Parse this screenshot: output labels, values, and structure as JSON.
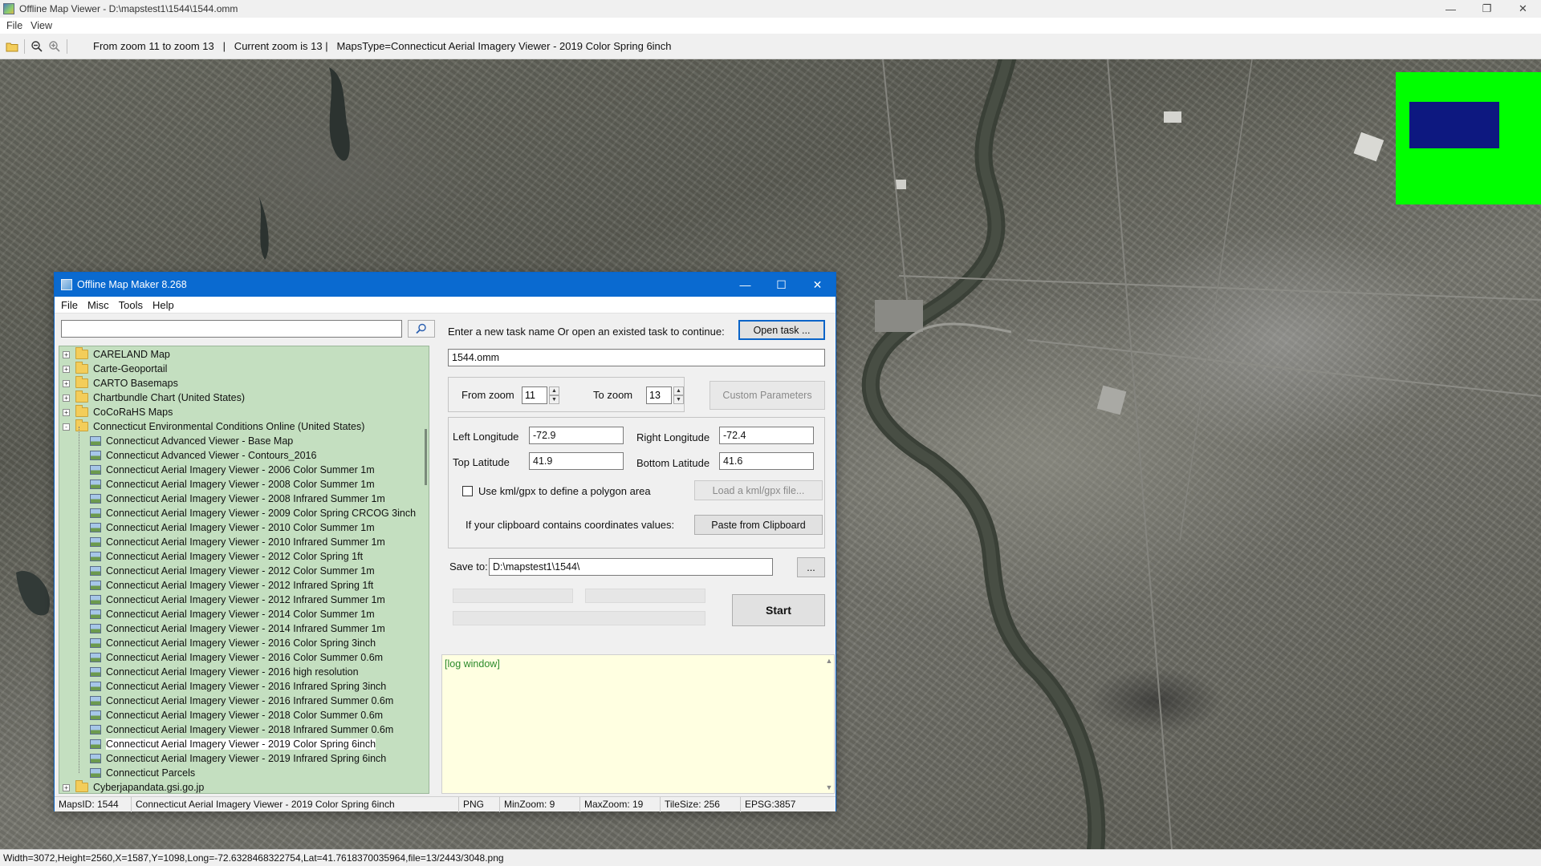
{
  "viewer": {
    "title": "Offline Map Viewer - D:\\mapstest1\\1544\\1544.omm",
    "menu": [
      "File",
      "View"
    ],
    "toolbar_status": "From zoom 11 to zoom 13   |   Current zoom is 13 |   MapsType=Connecticut Aerial Imagery Viewer - 2019 Color Spring 6inch",
    "statusbar": "Width=3072,Height=2560,X=1587,Y=1098,Long=-72.6328468322754,Lat=41.7618370035964,file=13/2443/3048.png",
    "overview_colors": {
      "background": "#00ff00",
      "viewport": "#0d1880"
    }
  },
  "dialog": {
    "title": "Offline Map Maker 8.268",
    "menu": [
      "File",
      "Misc",
      "Tools",
      "Help"
    ],
    "search_placeholder": "",
    "tree": [
      {
        "label": "CARELAND Map",
        "type": "folder",
        "level": 0,
        "expander": "+"
      },
      {
        "label": "Carte-Geoportail",
        "type": "folder",
        "level": 0,
        "expander": "+"
      },
      {
        "label": "CARTO Basemaps",
        "type": "folder",
        "level": 0,
        "expander": "+"
      },
      {
        "label": "Chartbundle Chart (United States)",
        "type": "folder",
        "level": 0,
        "expander": "+"
      },
      {
        "label": "CoCoRaHS Maps",
        "type": "folder",
        "level": 0,
        "expander": "+"
      },
      {
        "label": "Connecticut Environmental Conditions Online (United States)",
        "type": "folder-open",
        "level": 0,
        "expander": "−"
      },
      {
        "label": "Connecticut Advanced Viewer - Base Map",
        "type": "map",
        "level": 1
      },
      {
        "label": "Connecticut Advanced Viewer - Contours_2016",
        "type": "map",
        "level": 1
      },
      {
        "label": "Connecticut Aerial Imagery Viewer - 2006 Color Summer 1m",
        "type": "map",
        "level": 1
      },
      {
        "label": "Connecticut Aerial Imagery Viewer - 2008 Color Summer 1m",
        "type": "map",
        "level": 1
      },
      {
        "label": "Connecticut Aerial Imagery Viewer - 2008 Infrared Summer 1m",
        "type": "map",
        "level": 1
      },
      {
        "label": "Connecticut Aerial Imagery Viewer - 2009 Color Spring CRCOG 3inch",
        "type": "map",
        "level": 1
      },
      {
        "label": "Connecticut Aerial Imagery Viewer - 2010 Color Summer 1m",
        "type": "map",
        "level": 1
      },
      {
        "label": "Connecticut Aerial Imagery Viewer - 2010 Infrared Summer 1m",
        "type": "map",
        "level": 1
      },
      {
        "label": "Connecticut Aerial Imagery Viewer - 2012 Color Spring 1ft",
        "type": "map",
        "level": 1
      },
      {
        "label": "Connecticut Aerial Imagery Viewer - 2012 Color Summer 1m",
        "type": "map",
        "level": 1
      },
      {
        "label": "Connecticut Aerial Imagery Viewer - 2012 Infrared Spring 1ft",
        "type": "map",
        "level": 1
      },
      {
        "label": "Connecticut Aerial Imagery Viewer - 2012 Infrared Summer 1m",
        "type": "map",
        "level": 1
      },
      {
        "label": "Connecticut Aerial Imagery Viewer - 2014 Color Summer 1m",
        "type": "map",
        "level": 1
      },
      {
        "label": "Connecticut Aerial Imagery Viewer - 2014 Infrared Summer 1m",
        "type": "map",
        "level": 1
      },
      {
        "label": "Connecticut Aerial Imagery Viewer - 2016 Color Spring 3inch",
        "type": "map",
        "level": 1
      },
      {
        "label": "Connecticut Aerial Imagery Viewer - 2016 Color Summer 0.6m",
        "type": "map",
        "level": 1
      },
      {
        "label": "Connecticut Aerial Imagery Viewer - 2016 high resolution",
        "type": "map",
        "level": 1
      },
      {
        "label": "Connecticut Aerial Imagery Viewer - 2016 Infrared Spring 3inch",
        "type": "map",
        "level": 1
      },
      {
        "label": "Connecticut Aerial Imagery Viewer - 2016 Infrared Summer 0.6m",
        "type": "map",
        "level": 1
      },
      {
        "label": "Connecticut Aerial Imagery Viewer - 2018 Color Summer 0.6m",
        "type": "map",
        "level": 1
      },
      {
        "label": "Connecticut Aerial Imagery Viewer - 2018 Infrared Summer 0.6m",
        "type": "map",
        "level": 1
      },
      {
        "label": "Connecticut Aerial Imagery Viewer - 2019 Color Spring 6inch",
        "type": "map",
        "level": 1,
        "selected": true
      },
      {
        "label": "Connecticut Aerial Imagery Viewer - 2019 Infrared Spring 6inch",
        "type": "map",
        "level": 1
      },
      {
        "label": "Connecticut Parcels",
        "type": "map",
        "level": 1
      },
      {
        "label": "Cyberjapandata.gsi.go.jp",
        "type": "folder",
        "level": 0,
        "expander": "+"
      }
    ],
    "task_prompt": "Enter a new task name Or open an existed task to continue:",
    "open_task_label": "Open task ...",
    "task_name": "1544.omm",
    "from_zoom_label": "From zoom",
    "from_zoom_value": "11",
    "to_zoom_label": "To zoom",
    "to_zoom_value": "13",
    "custom_params_label": "Custom Parameters",
    "left_lon_label": "Left Longitude",
    "left_lon_value": "-72.9",
    "right_lon_label": "Right Longitude",
    "right_lon_value": "-72.4",
    "top_lat_label": "Top Latitude",
    "top_lat_value": "41.9",
    "bottom_lat_label": "Bottom Latitude",
    "bottom_lat_value": "41.6",
    "kml_checkbox_label": "Use kml/gpx to define a polygon area",
    "kml_checked": false,
    "load_kml_label": "Load a kml/gpx file...",
    "clipboard_prompt": "If your clipboard contains coordinates values:",
    "paste_clipboard_label": "Paste from Clipboard",
    "save_to_label": "Save to:",
    "save_to_value": "D:\\mapstest1\\1544\\",
    "browse_label": "...",
    "start_label": "Start",
    "log_text": "[log window]",
    "statusbar": {
      "maps_id": "MapsID: 1544",
      "map_name": "Connecticut Aerial Imagery Viewer - 2019 Color Spring 6inch",
      "format": "PNG",
      "min_zoom": "MinZoom: 9",
      "max_zoom": "MaxZoom: 19",
      "tile_size": "TileSize: 256",
      "epsg": "EPSG:3857"
    }
  }
}
